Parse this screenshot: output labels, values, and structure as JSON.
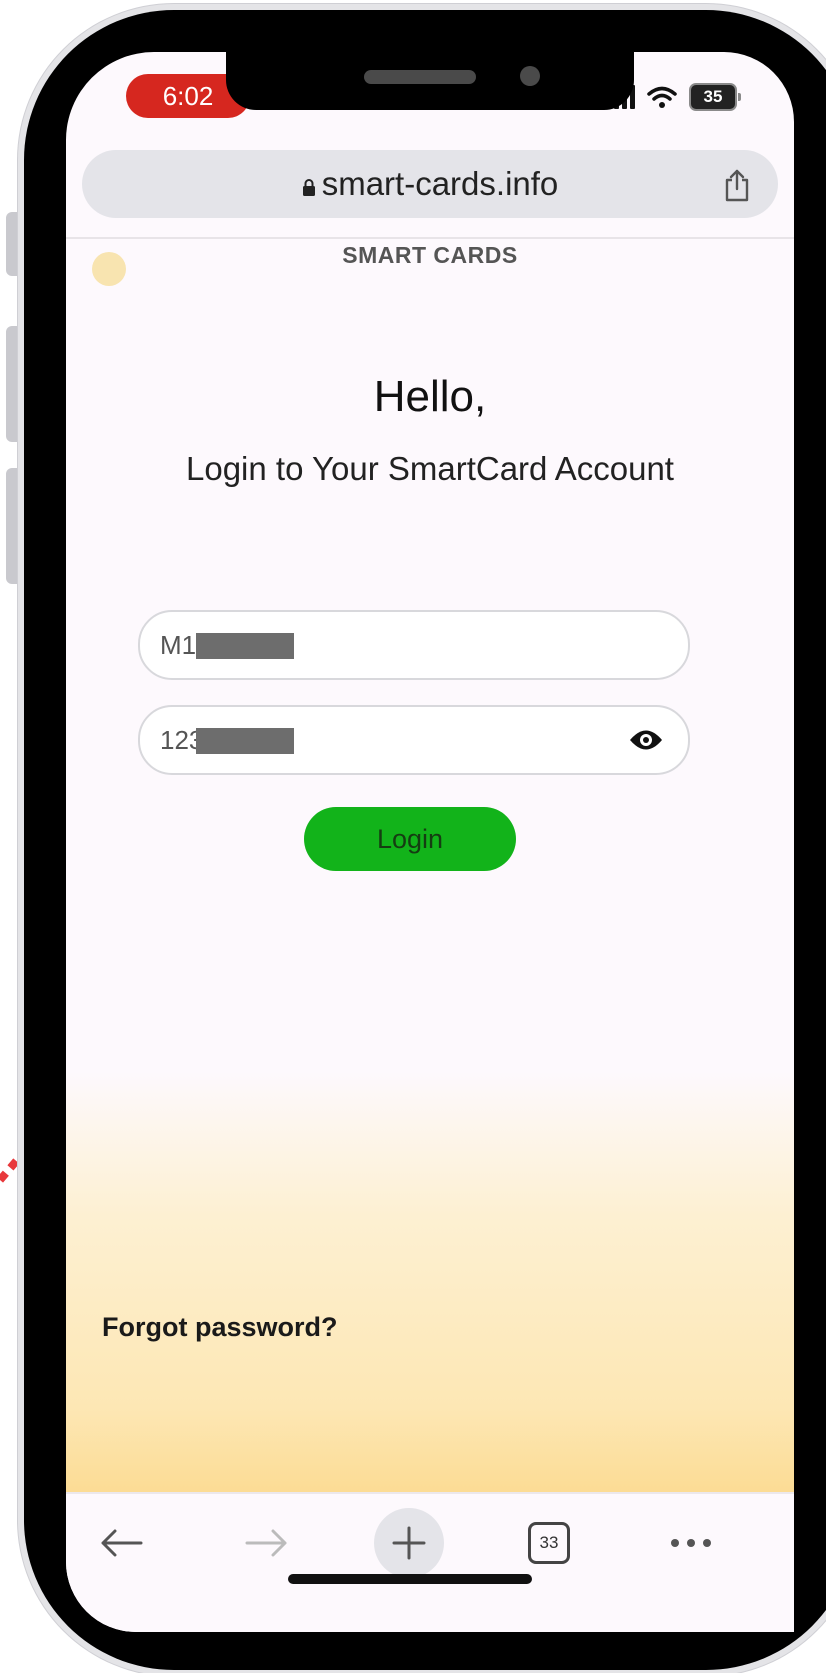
{
  "status_bar": {
    "time": "6:02",
    "battery": "35"
  },
  "browser": {
    "url": "smart-cards.info",
    "tabs_count": "33"
  },
  "page": {
    "brand": "SMART CARDS",
    "greeting": "Hello,",
    "subtitle": "Login to Your SmartCard Account",
    "username_value": "M1",
    "password_value": "123",
    "login_label": "Login",
    "forgot_label": "Forgot password?"
  },
  "colors": {
    "time_pill": "#d6271f",
    "login_button": "#12b31a",
    "annotation_arrows": "#e8383b"
  }
}
